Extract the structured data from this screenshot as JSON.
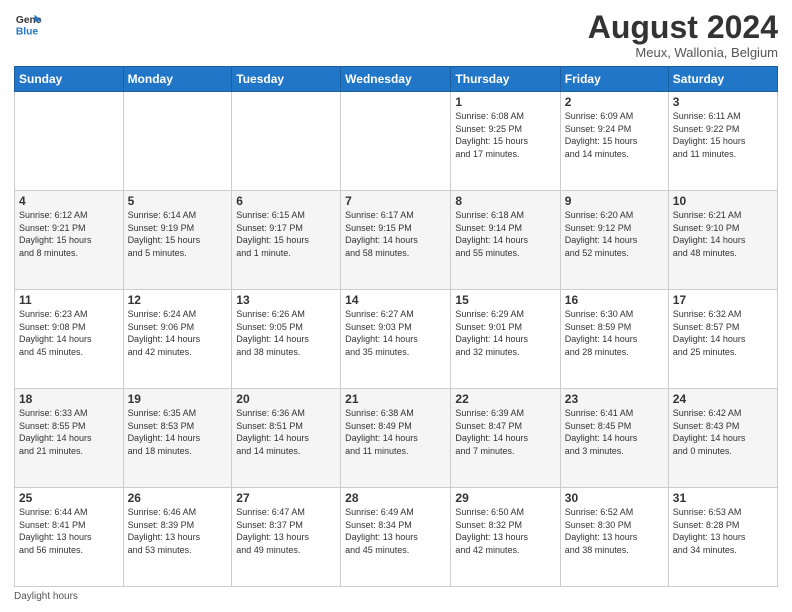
{
  "header": {
    "logo_line1": "General",
    "logo_line2": "Blue",
    "month_title": "August 2024",
    "subtitle": "Meux, Wallonia, Belgium"
  },
  "days_of_week": [
    "Sunday",
    "Monday",
    "Tuesday",
    "Wednesday",
    "Thursday",
    "Friday",
    "Saturday"
  ],
  "weeks": [
    [
      {
        "day": "",
        "info": ""
      },
      {
        "day": "",
        "info": ""
      },
      {
        "day": "",
        "info": ""
      },
      {
        "day": "",
        "info": ""
      },
      {
        "day": "1",
        "info": "Sunrise: 6:08 AM\nSunset: 9:25 PM\nDaylight: 15 hours\nand 17 minutes."
      },
      {
        "day": "2",
        "info": "Sunrise: 6:09 AM\nSunset: 9:24 PM\nDaylight: 15 hours\nand 14 minutes."
      },
      {
        "day": "3",
        "info": "Sunrise: 6:11 AM\nSunset: 9:22 PM\nDaylight: 15 hours\nand 11 minutes."
      }
    ],
    [
      {
        "day": "4",
        "info": "Sunrise: 6:12 AM\nSunset: 9:21 PM\nDaylight: 15 hours\nand 8 minutes."
      },
      {
        "day": "5",
        "info": "Sunrise: 6:14 AM\nSunset: 9:19 PM\nDaylight: 15 hours\nand 5 minutes."
      },
      {
        "day": "6",
        "info": "Sunrise: 6:15 AM\nSunset: 9:17 PM\nDaylight: 15 hours\nand 1 minute."
      },
      {
        "day": "7",
        "info": "Sunrise: 6:17 AM\nSunset: 9:15 PM\nDaylight: 14 hours\nand 58 minutes."
      },
      {
        "day": "8",
        "info": "Sunrise: 6:18 AM\nSunset: 9:14 PM\nDaylight: 14 hours\nand 55 minutes."
      },
      {
        "day": "9",
        "info": "Sunrise: 6:20 AM\nSunset: 9:12 PM\nDaylight: 14 hours\nand 52 minutes."
      },
      {
        "day": "10",
        "info": "Sunrise: 6:21 AM\nSunset: 9:10 PM\nDaylight: 14 hours\nand 48 minutes."
      }
    ],
    [
      {
        "day": "11",
        "info": "Sunrise: 6:23 AM\nSunset: 9:08 PM\nDaylight: 14 hours\nand 45 minutes."
      },
      {
        "day": "12",
        "info": "Sunrise: 6:24 AM\nSunset: 9:06 PM\nDaylight: 14 hours\nand 42 minutes."
      },
      {
        "day": "13",
        "info": "Sunrise: 6:26 AM\nSunset: 9:05 PM\nDaylight: 14 hours\nand 38 minutes."
      },
      {
        "day": "14",
        "info": "Sunrise: 6:27 AM\nSunset: 9:03 PM\nDaylight: 14 hours\nand 35 minutes."
      },
      {
        "day": "15",
        "info": "Sunrise: 6:29 AM\nSunset: 9:01 PM\nDaylight: 14 hours\nand 32 minutes."
      },
      {
        "day": "16",
        "info": "Sunrise: 6:30 AM\nSunset: 8:59 PM\nDaylight: 14 hours\nand 28 minutes."
      },
      {
        "day": "17",
        "info": "Sunrise: 6:32 AM\nSunset: 8:57 PM\nDaylight: 14 hours\nand 25 minutes."
      }
    ],
    [
      {
        "day": "18",
        "info": "Sunrise: 6:33 AM\nSunset: 8:55 PM\nDaylight: 14 hours\nand 21 minutes."
      },
      {
        "day": "19",
        "info": "Sunrise: 6:35 AM\nSunset: 8:53 PM\nDaylight: 14 hours\nand 18 minutes."
      },
      {
        "day": "20",
        "info": "Sunrise: 6:36 AM\nSunset: 8:51 PM\nDaylight: 14 hours\nand 14 minutes."
      },
      {
        "day": "21",
        "info": "Sunrise: 6:38 AM\nSunset: 8:49 PM\nDaylight: 14 hours\nand 11 minutes."
      },
      {
        "day": "22",
        "info": "Sunrise: 6:39 AM\nSunset: 8:47 PM\nDaylight: 14 hours\nand 7 minutes."
      },
      {
        "day": "23",
        "info": "Sunrise: 6:41 AM\nSunset: 8:45 PM\nDaylight: 14 hours\nand 3 minutes."
      },
      {
        "day": "24",
        "info": "Sunrise: 6:42 AM\nSunset: 8:43 PM\nDaylight: 14 hours\nand 0 minutes."
      }
    ],
    [
      {
        "day": "25",
        "info": "Sunrise: 6:44 AM\nSunset: 8:41 PM\nDaylight: 13 hours\nand 56 minutes."
      },
      {
        "day": "26",
        "info": "Sunrise: 6:46 AM\nSunset: 8:39 PM\nDaylight: 13 hours\nand 53 minutes."
      },
      {
        "day": "27",
        "info": "Sunrise: 6:47 AM\nSunset: 8:37 PM\nDaylight: 13 hours\nand 49 minutes."
      },
      {
        "day": "28",
        "info": "Sunrise: 6:49 AM\nSunset: 8:34 PM\nDaylight: 13 hours\nand 45 minutes."
      },
      {
        "day": "29",
        "info": "Sunrise: 6:50 AM\nSunset: 8:32 PM\nDaylight: 13 hours\nand 42 minutes."
      },
      {
        "day": "30",
        "info": "Sunrise: 6:52 AM\nSunset: 8:30 PM\nDaylight: 13 hours\nand 38 minutes."
      },
      {
        "day": "31",
        "info": "Sunrise: 6:53 AM\nSunset: 8:28 PM\nDaylight: 13 hours\nand 34 minutes."
      }
    ]
  ],
  "footer": {
    "label": "Daylight hours"
  }
}
